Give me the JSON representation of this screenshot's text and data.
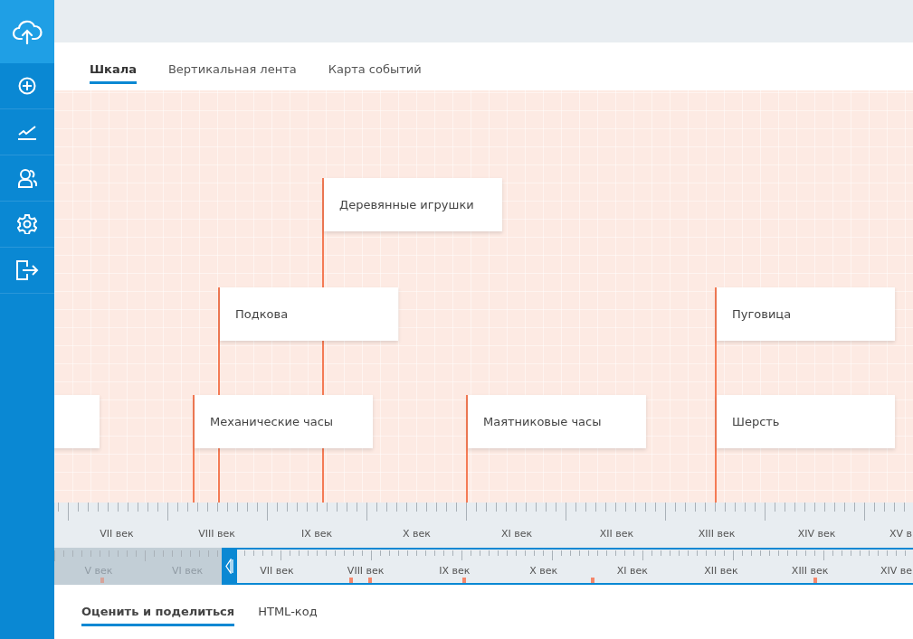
{
  "tabs": [
    {
      "label": "Шкала",
      "selected": true
    },
    {
      "label": "Вертикальная лента",
      "selected": false
    },
    {
      "label": "Карта событий",
      "selected": false
    }
  ],
  "events": [
    {
      "title": "Деревянные игрушки"
    },
    {
      "title": "Подкова"
    },
    {
      "title": "Механические часы"
    },
    {
      "title": "Маятниковые часы"
    },
    {
      "title": "Пуговица"
    },
    {
      "title": "Шерсть"
    }
  ],
  "axis": {
    "labels": [
      "VII век",
      "VIII век",
      "IX век",
      "X век",
      "XI век",
      "XII век",
      "XIII век",
      "XIV век",
      "XV в"
    ]
  },
  "minimap": {
    "outside_labels": [
      "V век",
      "VI век"
    ],
    "labels": [
      "VII век",
      "VIII век",
      "IX век",
      "X век",
      "XI век",
      "XII век",
      "XIII век",
      "XIV ве"
    ]
  },
  "share_tabs": [
    {
      "label": "Оценить и поделиться",
      "selected": true
    },
    {
      "label": "HTML-код",
      "selected": false
    }
  ]
}
